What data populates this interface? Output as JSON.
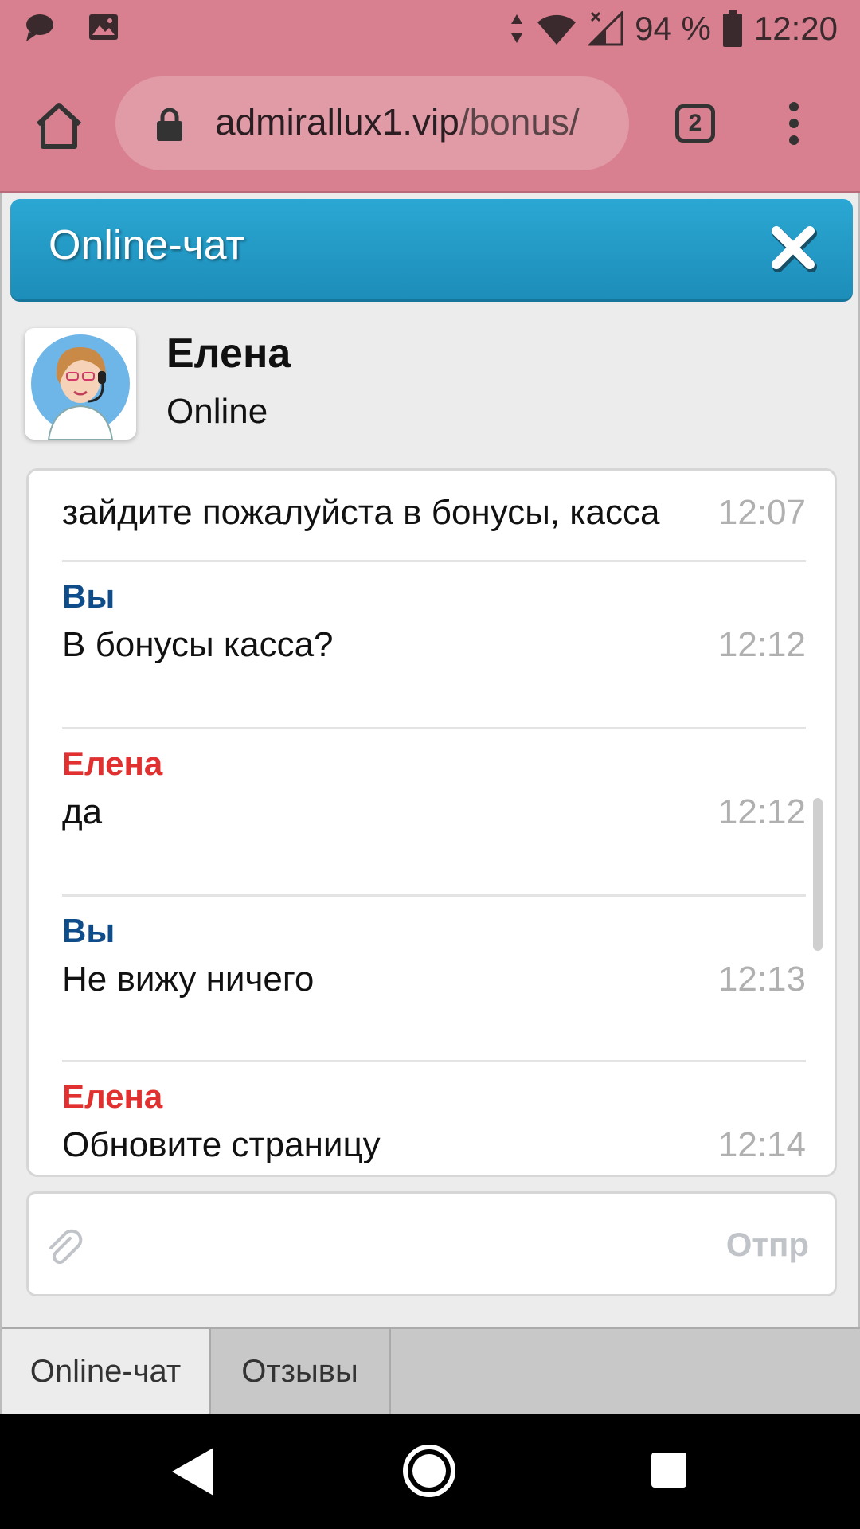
{
  "status_bar": {
    "battery": "94 %",
    "time": "12:20"
  },
  "browser": {
    "url_domain": "admirallux1.vip",
    "url_path": "/bonus/",
    "tab_count": "2"
  },
  "chat": {
    "title": "Online-чат",
    "agent": {
      "name": "Елена",
      "status": "Online"
    },
    "messages": [
      {
        "sender": "",
        "text": "зайдите пожалуйста в бонусы, касса",
        "time": "12:07"
      },
      {
        "sender": "Вы",
        "text": "В бонусы касса?",
        "time": "12:12"
      },
      {
        "sender": "Елена",
        "text": "да",
        "time": "12:12"
      },
      {
        "sender": "Вы",
        "text": "Не вижу ничего",
        "time": "12:13"
      },
      {
        "sender": "Елена",
        "text": "Обновите страницу",
        "time": "12:14"
      }
    ],
    "input": {
      "placeholder": "",
      "send_label": "Отпр"
    }
  },
  "bottom_tabs": [
    {
      "label": "Online-чат",
      "active": true
    },
    {
      "label": "Отзывы",
      "active": false
    }
  ],
  "colors": {
    "browser_chrome": "#d8808f",
    "header_blue": "#2ba7d3",
    "sender_you": "#0f4c8a",
    "sender_agent": "#e03030"
  },
  "icons": {
    "status_left": [
      "chat-bubble-icon",
      "image-icon"
    ],
    "status_right": [
      "data-arrows-icon",
      "wifi-icon",
      "signal-icon",
      "battery-icon"
    ],
    "nav": [
      "back-icon",
      "home-icon",
      "recents-icon"
    ]
  }
}
